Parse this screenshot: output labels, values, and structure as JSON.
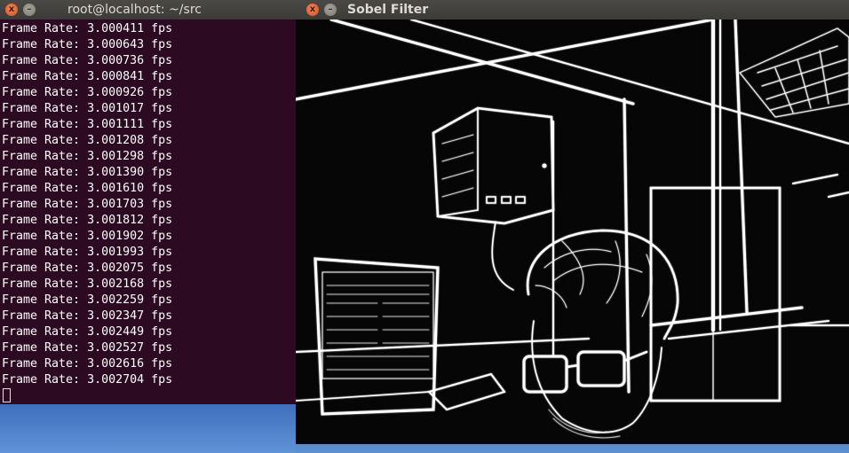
{
  "terminal": {
    "title": "root@localhost: ~/src",
    "close_glyph": "x",
    "min_glyph": "–",
    "lines": [
      "Frame Rate: 3.000411 fps",
      "Frame Rate: 3.000643 fps",
      "Frame Rate: 3.000736 fps",
      "Frame Rate: 3.000841 fps",
      "Frame Rate: 3.000926 fps",
      "Frame Rate: 3.001017 fps",
      "Frame Rate: 3.001111 fps",
      "Frame Rate: 3.001208 fps",
      "Frame Rate: 3.001298 fps",
      "Frame Rate: 3.001390 fps",
      "Frame Rate: 3.001610 fps",
      "Frame Rate: 3.001703 fps",
      "Frame Rate: 3.001812 fps",
      "Frame Rate: 3.001902 fps",
      "Frame Rate: 3.001993 fps",
      "Frame Rate: 3.002075 fps",
      "Frame Rate: 3.002168 fps",
      "Frame Rate: 3.002259 fps",
      "Frame Rate: 3.002347 fps",
      "Frame Rate: 3.002449 fps",
      "Frame Rate: 3.002527 fps",
      "Frame Rate: 3.002616 fps",
      "Frame Rate: 3.002704 fps"
    ]
  },
  "sobel_window": {
    "title": "Sobel Filter",
    "close_glyph": "x",
    "min_glyph": "–"
  },
  "colors": {
    "terminal_bg": "#2c0a22",
    "titlebar_bg": "#3c3b37",
    "close_button": "#e0541e",
    "desktop_bg": "#2a5aa8"
  }
}
